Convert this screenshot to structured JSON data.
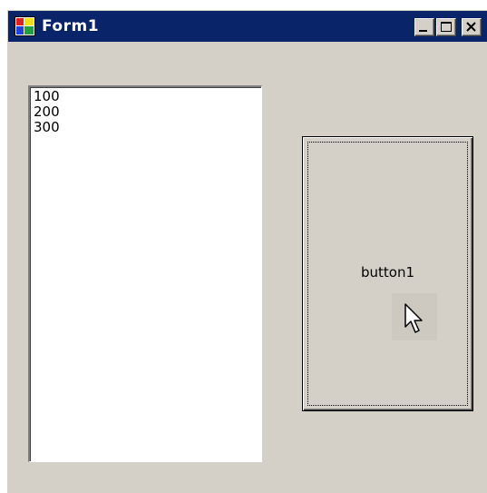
{
  "window": {
    "title": "Form1",
    "controls": [
      "minimize-icon",
      "maximize-icon",
      "close-icon"
    ]
  },
  "listbox": {
    "items": [
      "100",
      "200",
      "300"
    ]
  },
  "button1": {
    "label": "button1"
  },
  "colors": {
    "titlebar": "#0a246a",
    "face": "#d4d0c8"
  }
}
